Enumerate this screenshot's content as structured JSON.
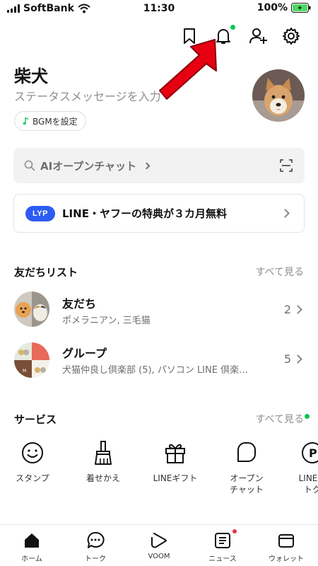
{
  "status_bar": {
    "carrier": "SoftBank",
    "time": "11:30",
    "battery": "100%"
  },
  "header": {
    "icons": [
      "bookmark-icon",
      "bell-icon",
      "add-friend-icon",
      "gear-icon"
    ]
  },
  "profile": {
    "name": "柴犬",
    "status_message": "ステータスメッセージを入力",
    "bgm_label": "BGMを設定"
  },
  "search": {
    "label": "AIオープンチャット"
  },
  "banner": {
    "badge": "LYP",
    "text": "LINE・ヤフーの特典が３カ月無料"
  },
  "friends_section": {
    "title": "友だちリスト",
    "see_all": "すべて見る",
    "rows": [
      {
        "title": "友だち",
        "subtitle": "ポメラニアン, 三毛猫",
        "count": "2"
      },
      {
        "title": "グループ",
        "subtitle": "犬猫仲良し倶楽部 (5), パソコン LINE 倶楽…",
        "count": "5"
      }
    ]
  },
  "services_section": {
    "title": "サービス",
    "see_all": "すべて見る",
    "items": [
      {
        "label": "スタンプ",
        "icon": "smiley-icon"
      },
      {
        "label": "着せかえ",
        "icon": "brush-icon"
      },
      {
        "label": "LINEギフト",
        "icon": "gift-icon"
      },
      {
        "label": "オープン\nチャット",
        "icon": "open-chat-icon"
      },
      {
        "label": "LINEか\nトク",
        "icon": "line-coupon-icon"
      }
    ]
  },
  "tab_bar": {
    "tabs": [
      {
        "label": "ホーム",
        "icon": "home-icon"
      },
      {
        "label": "トーク",
        "icon": "chat-icon"
      },
      {
        "label": "VOOM",
        "icon": "voom-icon"
      },
      {
        "label": "ニュース",
        "icon": "news-icon"
      },
      {
        "label": "ウォレット",
        "icon": "wallet-icon"
      }
    ]
  },
  "colors": {
    "accent_green": "#06c755",
    "notification_red": "#e8334a",
    "lyp_blue": "#2d5cf2",
    "arrow_red": "#e60012"
  }
}
